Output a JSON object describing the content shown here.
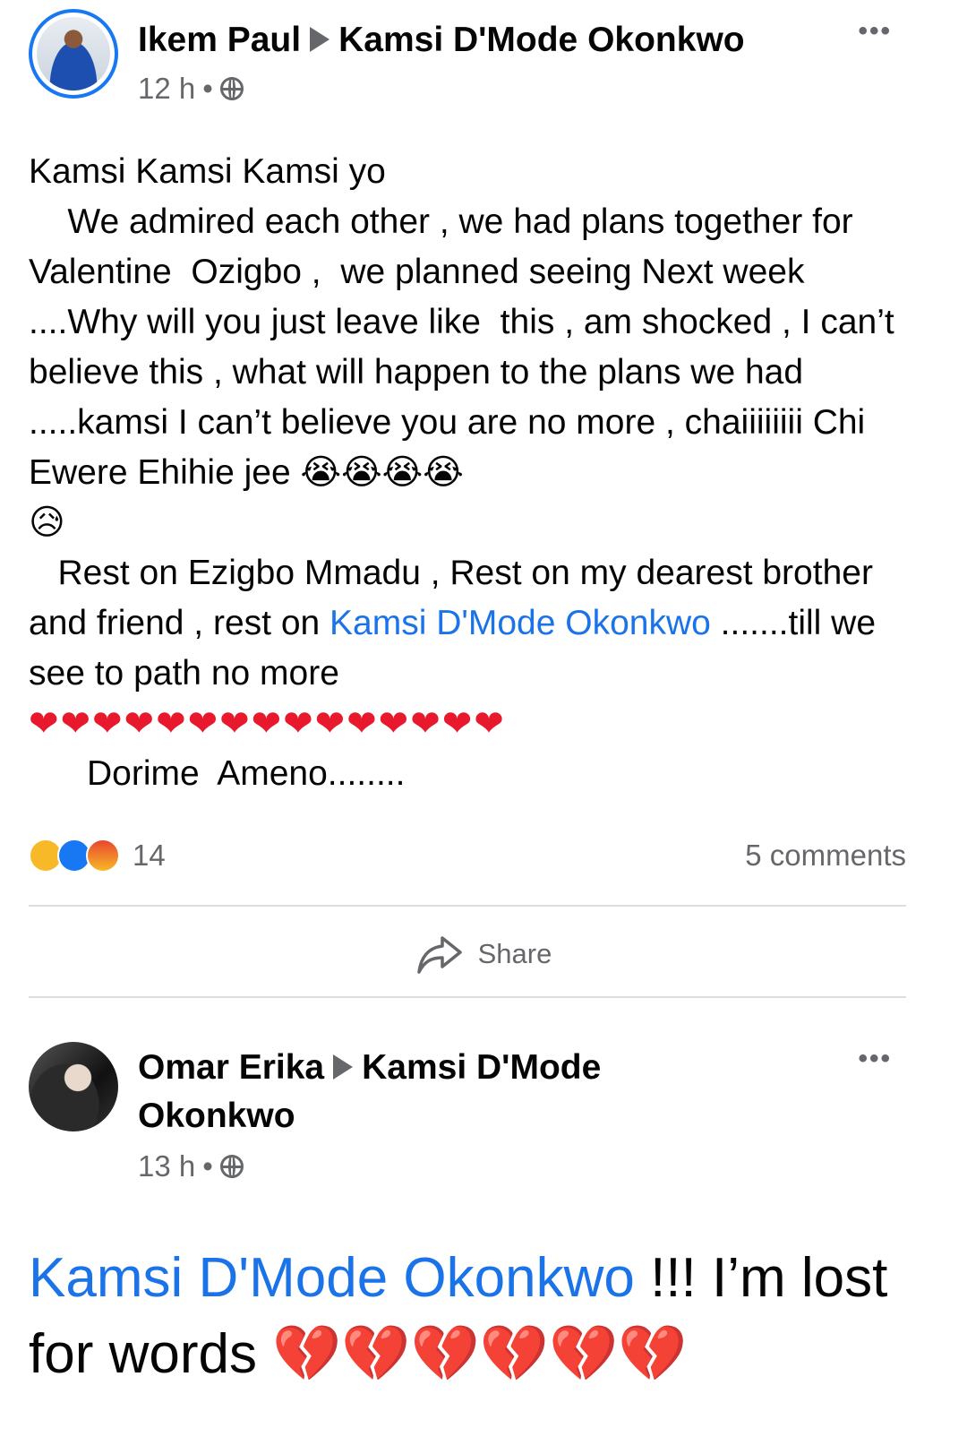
{
  "post1": {
    "author": "Ikem Paul",
    "target": "Kamsi D'Mode Okonkwo",
    "time": "12 h",
    "separator": "•",
    "more": "•••",
    "line1": "Kamsi Kamsi Kamsi yo",
    "para1": "    We admired each other , we had plans together for Valentine  Ozigbo ,  we planned seeing Next week ....Why will you just leave like  this , am shocked , I can’t believe this , what will happen to the plans we had .....kamsi I can’t believe you are no more , chaiiiiiiii Chi Ewere Ehihie jee ",
    "crying_emojis": "😭😭😭😭",
    "sad_emoji": "😥",
    "para2_start": "   Rest on Ezigbo Mmadu , Rest on my dearest brother and friend , rest on ",
    "para2_mention": "Kamsi D'Mode Okonkwo",
    "para2_end": " .......till we see to path no more",
    "hearts": "❤❤❤❤❤❤❤❤❤❤❤❤❤❤❤",
    "closing": "      Dorime  Ameno........",
    "reaction_count": "14",
    "comments": "5 comments",
    "share_label": "Share"
  },
  "post2": {
    "author": "Omar Erika",
    "target": "Kamsi D'Mode Okonkwo",
    "time": "13 h",
    "separator": "•",
    "more": "•••",
    "mention": "Kamsi D'Mode Okonkwo",
    "text_after_mention": " !!! I’m lost for words ",
    "broken_hearts": "💔💔💔💔💔💔"
  },
  "colors": {
    "accent": "#1877f2",
    "mention": "#1a73e8",
    "secondary_text": "#65676b",
    "heart": "#e8192c"
  },
  "icons": [
    "globe-icon",
    "more-icon",
    "arrow-icon",
    "share-icon",
    "sad-reaction-icon",
    "like-reaction-icon",
    "angry-reaction-icon"
  ]
}
